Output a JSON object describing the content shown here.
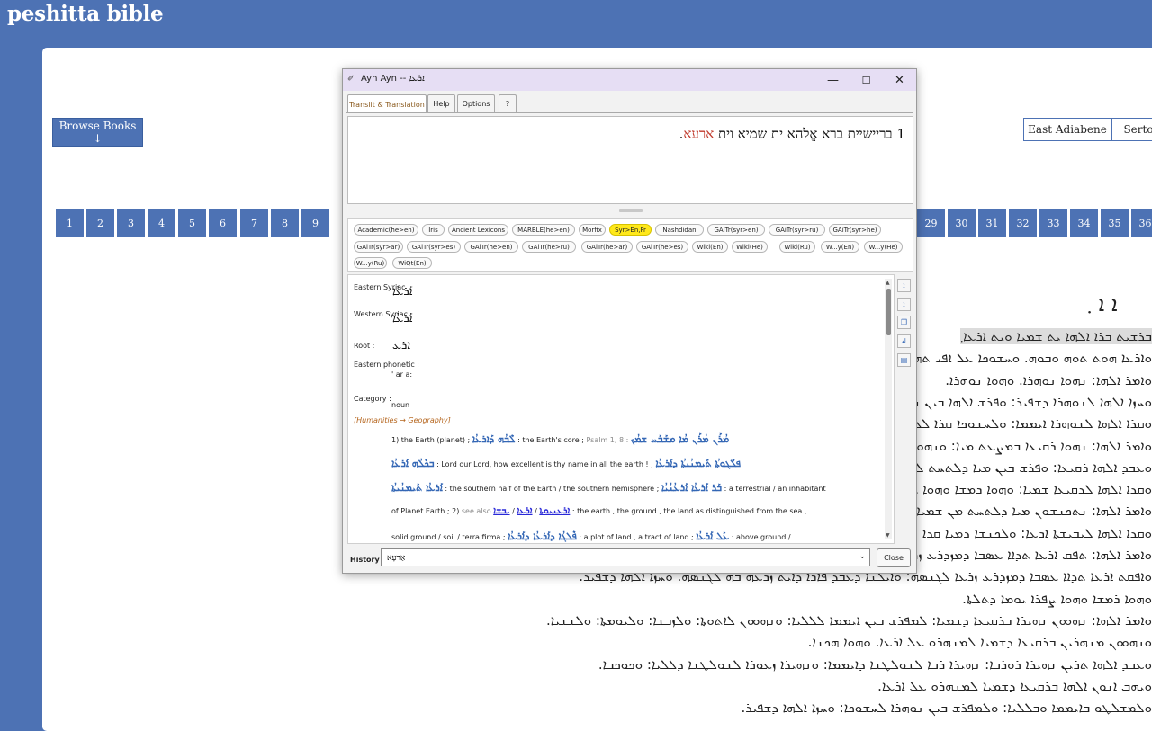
{
  "site": {
    "title": "peshitta bible"
  },
  "nav": {
    "browse_label": "Browse Books ↓",
    "dialects": [
      "East Adiabene",
      "Serto"
    ],
    "chapters_left": [
      "1",
      "2",
      "3",
      "4",
      "5",
      "6",
      "7",
      "8",
      "9"
    ],
    "chapters_right": [
      "29",
      "30",
      "31",
      "32",
      "33",
      "34",
      "35",
      "36"
    ]
  },
  "main": {
    "chapter_heading": "ܐ ܐ ܂",
    "verses": [
      "ܒܪܫܝܬ ܒܪܐ ܐܠܗܐ ܝܬ ܫܡܝܐ ܘܝܬ ܐܪܥܐ܂",
      "ܘܐܪܥܐ ܗܘܬ ܬܘܗ ܘܒܘܗ. ܘܚܫܘܟܐ ܥܠ ܐܦܝ ܬܗܘܡܐ.",
      "ܘܐܡܪ ܐܠܗܐ: ܢܗܘܐ ܢܘܗܪܐ. ܘܗܘܐ ܢܘܗܪܐ.",
      "ܘܚܙܐ ܐܠܗܐ ܠܢܘܗܪܐ ܕܫܦܝܪ: ܘܦܪܫ ܐܠܗܐ ܒܝܢ ܢܘܗܪܐ",
      "ܘܩܪܐ ܐܠܗܐ ܠܢܘܗܪܐ ܐܝܡܡܐ: ܘܠܚܫܘܟܐ ܩܪܐ ܠܠܝܐ",
      "ܘܐܡܪ ܐܠܗܐ: ܢܗܘܐ ܪܩܝܥܐ ܒܡܨܥܬ ܡܝܐ: ܘܢܗܘܐ ܦܪܫ",
      "ܘܥܒܕ ܐܠܗܐ ܪܩܝܥܐ: ܘܦܪܫ ܒܝܢ ܡܝܐ ܕܠܬܚܬ ܠܪܩܝܥܐ",
      "ܘܩܪܐ ܐܠܗܐ ܠܪܩܝܥܐ ܫܡܝܐ: ܘܗܘܐ ܪܡܫܐ ܘܗܘܐ ܨܦܪܐ",
      "ܘܐܡܪ ܐܠܗܐ: ܢܬܟܢܫܘܢ ܡܝܐ ܕܠܬܚܬ ܡܢ ܫܡܝܐ ܠܕܘܟܐ",
      "ܘܩܪܐ ܐܠܗܐ ܠܝܒܝܫܬܐ ܐܪܥܐ: ܘܠܟܢܫܐ ܕܡܝܐ ܩܪܐ",
      "ܘܐܡܪ ܐܠܗܐ: ܬܦܩ ܐܪܥܐ ܬܕܐܐ ܥܣܒܐ ܕܡܙܕܪܥ ܙܪܥܐ",
      "ܘܐܦܩܬ ܐܪܥܐ ܬܕܐܐ ܥܣܒܐ ܕܡܙܕܪܥ ܙܪܥܐ ܠܓܢܣܗ: ܘܐܝܠܢܐ ܕܥܒܕ ܦܐܪܐ ܕܐܝܬ ܙܪܥܗ ܒܗ ܠܓܢܣܗ. ܘܚܙܐ ܐܠܗܐ ܕܫܦܝܪ.",
      "ܘܗܘܐ ܪܡܫܐ ܘܗܘܐ ܨܦܪܐ ܝܘܡܐ ܕܬܠܬܐ.",
      "ܘܐܡܪ ܐܠܗܐ: ܢܗܘܘܢ ܢܗܝܪܐ ܒܪܩܝܥܐ ܕܫܡܝܐ: ܠܡܦܪܫ ܒܝܢ ܐܝܡܡܐ ܠܠܠܝܐ: ܘܢܗܘܘܢ ܠܐܬܘܬܐ: ܘܠܙܒܢܐ: ܘܠܝܘܡܬܐ: ܘܠܫܢܝܐ.",
      "ܘܢܗܘܘܢ ܡܢܗܪܝܢ ܒܪܩܝܥܐ ܕܫܡܝܐ ܠܡܢܗܪܘ ܥܠ ܐܪܥܐ. ܘܗܘܐ ܗܟܢܐ.",
      "ܘܥܒܕ ܐܠܗܐ ܬܪܝܢ ܢܗܝܪܐ ܪܘܪܒܐ: ܢܗܝܪܐ ܪܒܐ ܠܫܘܠܛܢܐ ܕܐܝܡܡܐ: ܘܢܗܝܪܐ ܙܥܘܪܐ ܠܫܘܠܛܢܐ ܕܠܠܝܐ: ܘܟܘܟܒܐ.",
      "ܘܝܗܒ ܐܢܘܢ ܐܠܗܐ ܒܪܩܝܥܐ ܕܫܡܝܐ ܠܡܢܗܪܘ ܥܠ ܐܪܥܐ.",
      "ܘܠܡܫܠܛܘ ܒܐܝܡܡܐ ܘܒܠܠܝܐ: ܘܠܡܦܪܫ ܒܝܢ ܢܘܗܪܐ ܠܚܫܘܟܐ: ܘܚܙܐ ܐܠܗܐ ܕܫܦܝܪ."
    ]
  },
  "popup": {
    "title": "Ayn Ayn -- ܐܪܥܐ",
    "icon": "tool-icon",
    "controls": {
      "minimize": "—",
      "maximize": "☐",
      "close": "✕"
    },
    "tabs": [
      "Translit & Translation",
      "Help",
      "Options",
      "?"
    ],
    "hebrew": {
      "verse_no": "1",
      "text": "בריישיית ברא אֱלהא ית שמיא וית",
      "highlight": "ארעא",
      "end": "."
    },
    "lexicons": [
      {
        "label": "Academic(he>en)",
        "on": false
      },
      {
        "label": "Iris",
        "on": false
      },
      {
        "label": "Ancient Lexicons",
        "on": false
      },
      {
        "label": "MARBLE(he>en)",
        "on": false
      },
      {
        "label": "Morfix",
        "on": false
      },
      {
        "label": "Syr>En,Fr",
        "on": true
      },
      {
        "label": "Nashdidan",
        "on": false
      },
      {
        "label": "GAiTr(syr>en)",
        "on": false
      },
      {
        "label": "GAiTr(syr>ru)",
        "on": false
      },
      {
        "label": "GAiTr(syr>he)",
        "on": false
      },
      {
        "label": "GAiTr(syr>ar)",
        "on": false
      },
      {
        "label": "GAiTr(syr>es)",
        "on": false
      },
      {
        "label": "GAiTr(he>en)",
        "on": false
      },
      {
        "label": "GAiTr(he>ru)",
        "on": false
      },
      {
        "label": "GAiTr(he>ar)",
        "on": false
      },
      {
        "label": "GAiTr(he>es)",
        "on": false
      },
      {
        "label": "Wiki(En)",
        "on": false
      },
      {
        "label": "Wiki(He)",
        "on": false
      },
      {
        "label": "Wiki(Ru)",
        "on": false
      },
      {
        "label": "W...y(En)",
        "on": false
      },
      {
        "label": "W...y(He)",
        "on": false
      },
      {
        "label": "W...y(Ru)",
        "on": false
      },
      {
        "label": "WiQt(En)",
        "on": false
      }
    ],
    "entry": {
      "eastern_label": "Eastern Syriac :",
      "eastern_value": "ܐܰܪܥܳܐ",
      "western_label": "Western Syriac :",
      "western_value": "ܐܰܪܥܳܐ",
      "root_label": "Root :",
      "root_value": "ܐܪܥ",
      "phonetic_label": "Eastern phonetic :",
      "phonetic_value": "' ar a:",
      "category_label": "Category :",
      "category_value": "noun",
      "domain": "[Humanities → Geography]",
      "lines": [
        {
          "segs": [
            [
              "t",
              "1) the Earth (planet) ; "
            ],
            [
              "b",
              "ܠܶܒܳܗ ܕܰܐܪܥܳܐ"
            ],
            [
              "t",
              " : the Earth's core ; "
            ],
            [
              "g",
              "Psalm 1, 8 : "
            ],
            [
              "b",
              "ܡܳܪܰܢ ܡܳܪܰܢ ܡܳܐ ܡܫܰܒܰܚ ܫܡܳܟ"
            ]
          ]
        },
        {
          "segs": [
            [
              "b",
              "ܒܟܽܠܳܗ ܐܰܪܥܳܐ"
            ],
            [
              "t",
              " : Lord our Lord, how excellent is thy name in all the earth ! ; "
            ],
            [
              "b",
              "ܦܠܶܓܘܬܳܐ ܬܰܝܡܢܳܝܬܳܐ ܕܐܰܪܥܳܐ"
            ]
          ]
        },
        {
          "segs": [
            [
              "b",
              "ܐܰܪܥܳܐ ܬܰܝܡܢܳܝܬܳܐ"
            ],
            [
              "t",
              " : the southern half of the Earth / the southern hemisphere ; "
            ],
            [
              "b",
              "ܒܰܪ ܐܰܪܥܳܐ ܐܰܪܥܳܢܳܝܳܐ"
            ],
            [
              "t",
              " : a terrestrial / an inhabitant"
            ]
          ]
        },
        {
          "segs": [
            [
              "t",
              "of Planet Earth ; 2) "
            ],
            [
              "g",
              "see also "
            ],
            [
              "l",
              "ܐܪܥܢܝܘܬܐ"
            ],
            [
              "t",
              " / "
            ],
            [
              "l",
              "ܐܪܥܐ"
            ],
            [
              "t",
              " / "
            ],
            [
              "l",
              "ܝܒܫܐ"
            ],
            [
              "t",
              " : the earth , the ground , the land as distinguished from the sea ,"
            ]
          ]
        },
        {
          "segs": [
            [
              "t",
              "solid ground / soil / terra firma ; "
            ],
            [
              "b",
              "ܦܶܠܓܳܐ ܕܐܰܪܥܳܐ ܕܐܰܪܥܳܐ"
            ],
            [
              "t",
              " : a plot of land , a tract of land ; "
            ],
            [
              "b",
              "ܥܰܠ ܐܰܪܥܳܐ"
            ],
            [
              "t",
              " : above ground /"
            ]
          ]
        }
      ]
    },
    "history_label": "History",
    "history_value": "אַרעָא",
    "close_label": "Close"
  }
}
